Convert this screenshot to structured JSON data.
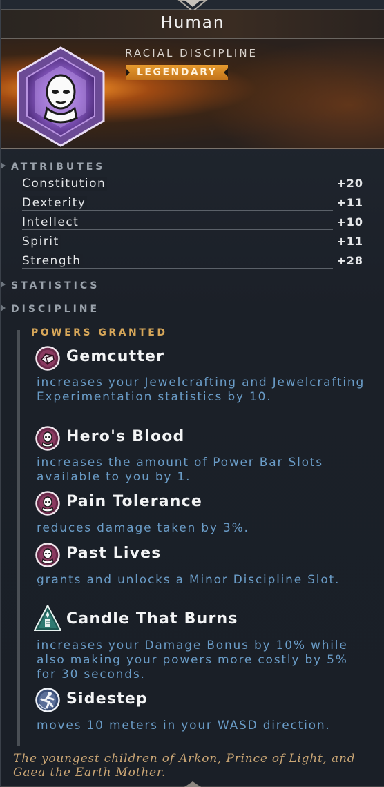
{
  "window": {
    "title": "Human"
  },
  "header": {
    "subtitle": "RACIAL DISCIPLINE",
    "rarity_badge": "LEGENDARY",
    "icon": "human-face-gem-icon",
    "colors": {
      "rarity": "#d88a23",
      "gem": "#8a5bc4",
      "glow": "#f29a2e"
    }
  },
  "sections": {
    "attributes": "ATTRIBUTES",
    "statistics": "STATISTICS",
    "discipline": "DISCIPLINE"
  },
  "attributes": [
    {
      "name": "Constitution",
      "value": "+20"
    },
    {
      "name": "Dexterity",
      "value": "+11"
    },
    {
      "name": "Intellect",
      "value": "+10"
    },
    {
      "name": "Spirit",
      "value": "+11"
    },
    {
      "name": "Strength",
      "value": "+28"
    }
  ],
  "powers_heading": "POWERS GRANTED",
  "powers": [
    {
      "name": "Gemcutter",
      "icon": "gem-cut-icon",
      "description": "increases your Jewelcrafting and Jewelcrafting Experimentation statistics by 10."
    },
    {
      "name": "Hero's Blood",
      "icon": "human-face-icon",
      "description": "increases the amount of Power Bar Slots available to you by 1."
    },
    {
      "name": "Pain Tolerance",
      "icon": "human-face-icon",
      "description": "reduces damage taken by 3%."
    },
    {
      "name": "Past Lives",
      "icon": "human-face-icon",
      "description": "grants and unlocks a Minor Discipline Slot."
    },
    {
      "name": "Candle That Burns",
      "icon": "candle-flame-icon",
      "description": "increases your Damage Bonus by 10% while also making your powers more costly by 5% for 30 seconds."
    },
    {
      "name": "Sidestep",
      "icon": "sidestep-runner-icon",
      "description": "moves 10 meters in your WASD direction."
    }
  ],
  "flavor_text": "The youngest children of Arkon, Prince of Light, and Gaea the Earth Mother.",
  "colors": {
    "background": "#1c2129",
    "description": "#6a9cc7",
    "powers_heading": "#d6a659",
    "flavor": "#c9a574"
  }
}
